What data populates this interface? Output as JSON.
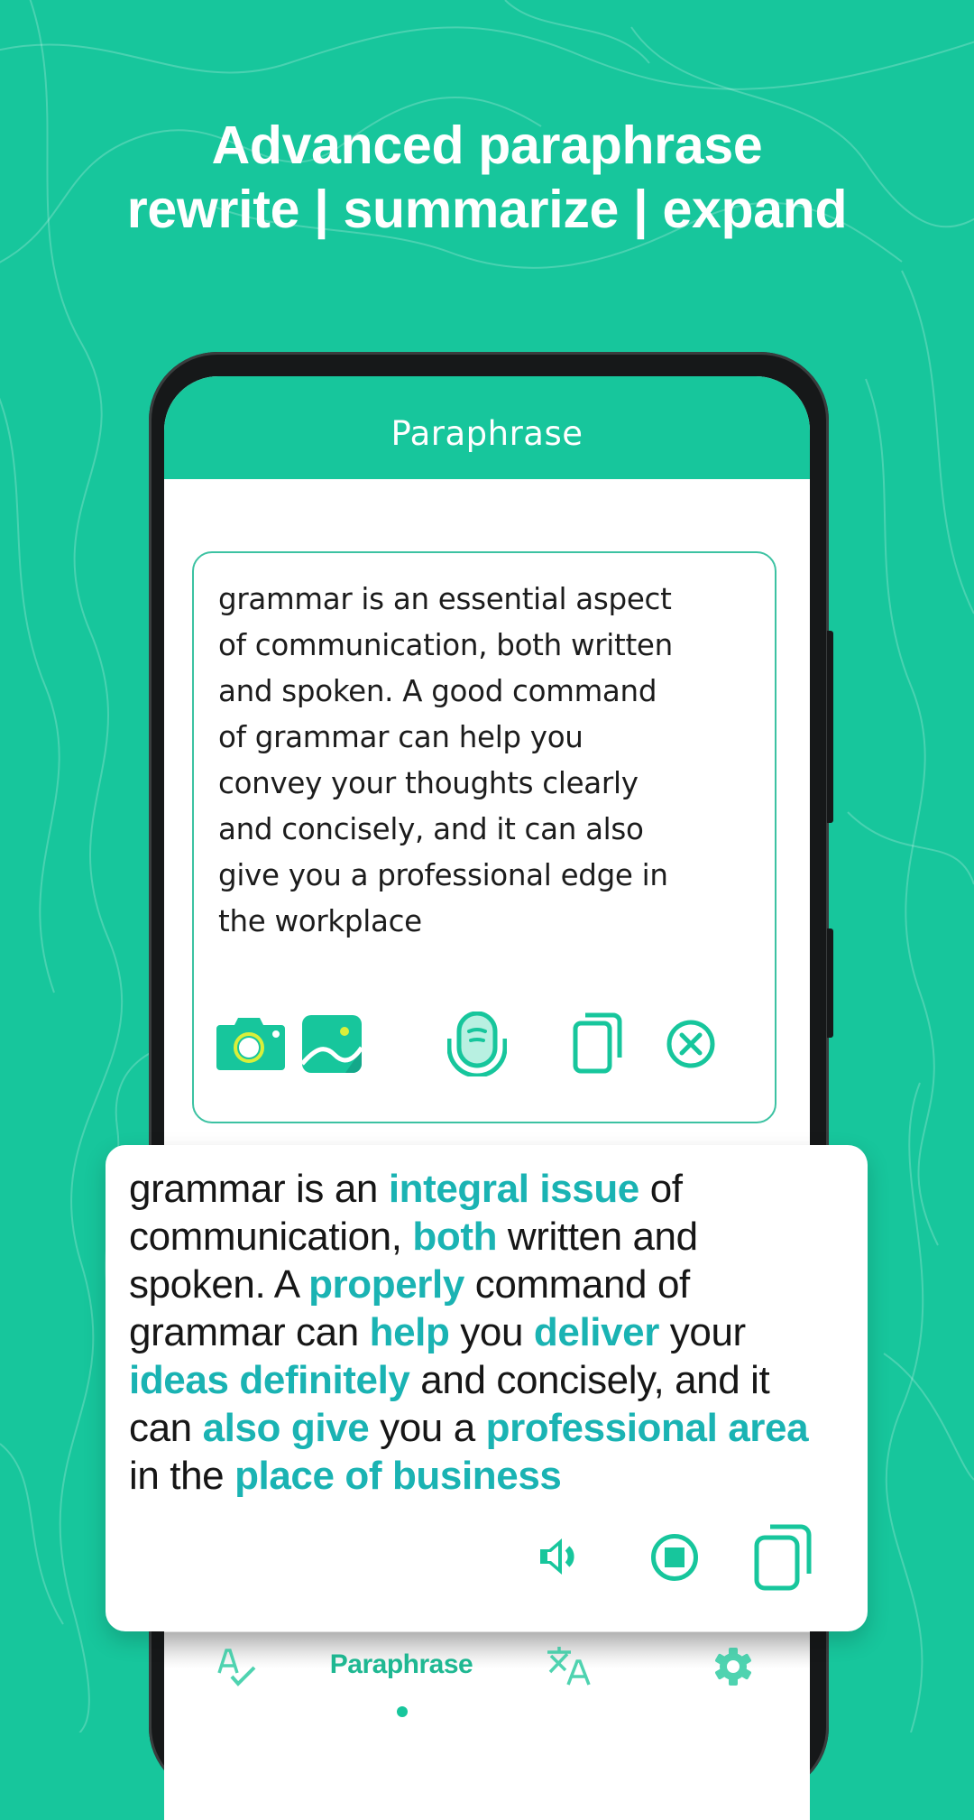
{
  "colors": {
    "background": "#17c69c",
    "accent": "#17c69c",
    "highlight": "#1ab3b3",
    "text": "#161616"
  },
  "headline": {
    "line1": "Advanced paraphrase",
    "line2": "rewrite | summarize | expand"
  },
  "app": {
    "title": "Paraphrase"
  },
  "input": {
    "lines": [
      "grammar is an essential aspect",
      "of communication, both written",
      "and spoken. A good command",
      "of grammar can help you",
      "convey your thoughts clearly",
      "and concisely, and it can also",
      "give you a professional edge in",
      "the workplace"
    ],
    "tools": [
      "camera-icon",
      "gallery-icon",
      "microphone-icon",
      "paste-icon",
      "clear-icon"
    ]
  },
  "result": {
    "lines": [
      [
        {
          "t": "grammar is an ",
          "h": false
        },
        {
          "t": "integral issue",
          "h": true
        },
        {
          "t": " of",
          "h": false
        }
      ],
      [
        {
          "t": "communication, ",
          "h": false
        },
        {
          "t": "both",
          "h": true
        },
        {
          "t": " written and",
          "h": false
        }
      ],
      [
        {
          "t": "spoken. A ",
          "h": false
        },
        {
          "t": "properly",
          "h": true
        },
        {
          "t": " command of",
          "h": false
        }
      ],
      [
        {
          "t": "grammar can ",
          "h": false
        },
        {
          "t": "help",
          "h": true
        },
        {
          "t": " you ",
          "h": false
        },
        {
          "t": "deliver",
          "h": true
        },
        {
          "t": " your",
          "h": false
        }
      ],
      [
        {
          "t": "ideas definitely",
          "h": true
        },
        {
          "t": " and concisely, and it",
          "h": false
        }
      ],
      [
        {
          "t": "can ",
          "h": false
        },
        {
          "t": "also give",
          "h": true
        },
        {
          "t": " you a ",
          "h": false
        },
        {
          "t": "professional area",
          "h": true
        }
      ],
      [
        {
          "t": "in the ",
          "h": false
        },
        {
          "t": "place of business",
          "h": true
        }
      ]
    ],
    "tools": [
      "speaker-icon",
      "stop-icon",
      "copy-icon"
    ]
  },
  "bottom_nav": {
    "items": [
      {
        "name": "grammar-check",
        "icon": "spellcheck-icon",
        "label": ""
      },
      {
        "name": "paraphrase",
        "icon": "",
        "label": "Paraphrase",
        "active": true
      },
      {
        "name": "translate",
        "icon": "translate-icon",
        "label": ""
      },
      {
        "name": "settings",
        "icon": "gear-icon",
        "label": ""
      }
    ]
  }
}
